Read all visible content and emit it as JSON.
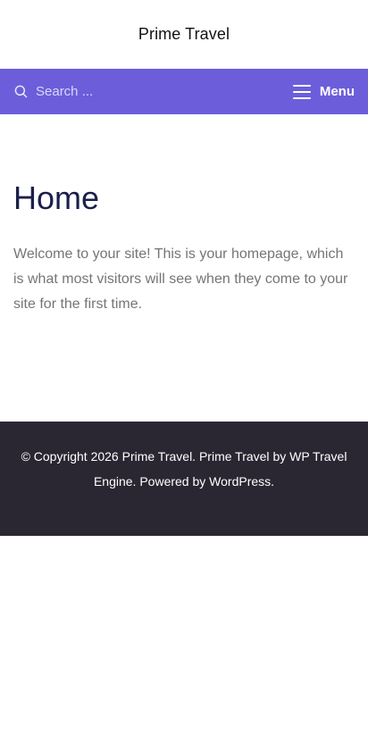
{
  "site": {
    "title": "Prime Travel"
  },
  "nav": {
    "search_placeholder": "Search ...",
    "search_icon": "search-icon",
    "menu_icon": "hamburger-menu-icon",
    "menu_label": "Menu"
  },
  "page": {
    "title": "Home",
    "body": "Welcome to your site! This is your homepage, which is what most visitors will see when they come to your site for the first time."
  },
  "footer": {
    "copyright": "© Copyright 2026 Prime Travel.",
    "site_link": "Prime Travel",
    "by_text": "by",
    "theme_link": "WP Travel Engine",
    "powered_text": "Powered by",
    "wp_link": "WordPress",
    "period": "."
  },
  "colors": {
    "accent": "#6c5ddb",
    "footer_bg": "#2a2732",
    "title_color": "#1b1f4a",
    "body_text": "#757575"
  }
}
